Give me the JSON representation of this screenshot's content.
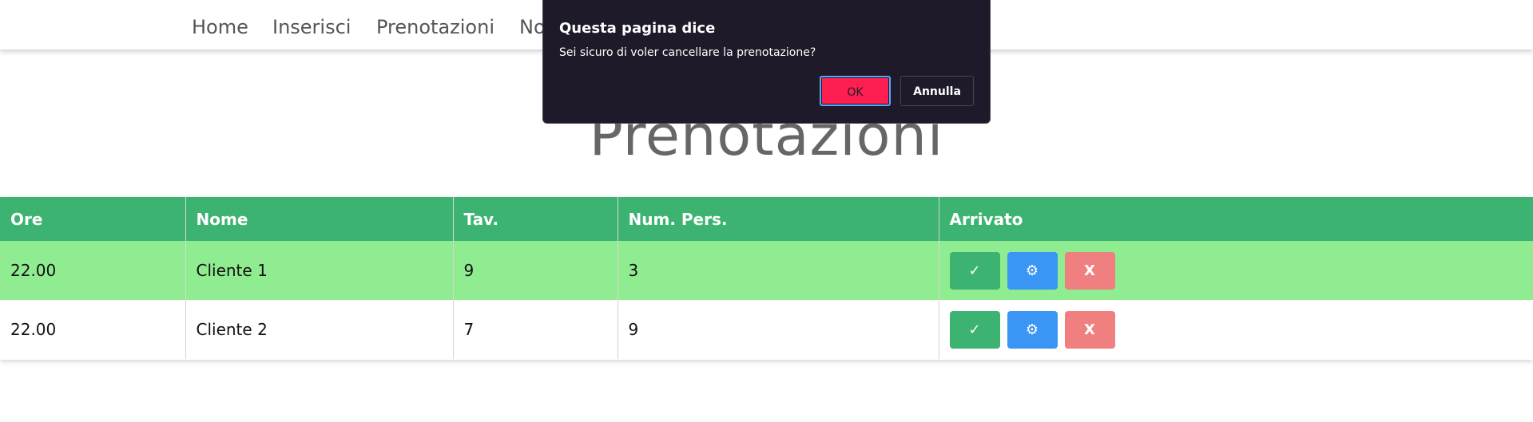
{
  "nav": {
    "links": [
      "Home",
      "Inserisci",
      "Prenotazioni",
      "No"
    ]
  },
  "page": {
    "title": "Prenotazioni"
  },
  "table": {
    "headers": [
      "Ore",
      "Nome",
      "Tav.",
      "Num. Pers.",
      "Arrivato"
    ],
    "rows": [
      {
        "ore": "22.00",
        "nome": "Cliente 1",
        "tav": "9",
        "pers": "3"
      },
      {
        "ore": "22.00",
        "nome": "Cliente 2",
        "tav": "7",
        "pers": "9"
      }
    ],
    "actions": {
      "check": "✓",
      "edit": "⚙",
      "delete": "X"
    }
  },
  "dialog": {
    "title": "Questa pagina dice",
    "message": "Sei sicuro di voler cancellare la prenotazione?",
    "ok_label": "OK",
    "cancel_label": "Annulla"
  },
  "colors": {
    "header_green": "#3db371",
    "row_highlight": "#90ec90",
    "edit_blue": "#3b95f5",
    "delete_red": "#f08080",
    "dialog_bg": "#1e1a29",
    "ok_button": "#ff1e50"
  }
}
